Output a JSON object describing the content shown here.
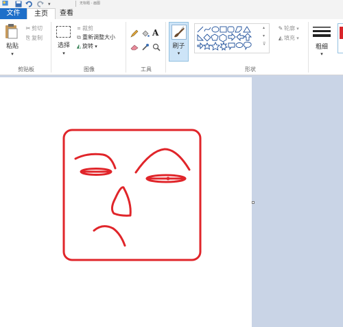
{
  "title_bar": {
    "doc_title": "无标题 - 画图"
  },
  "tabs": [
    {
      "label": "文件"
    },
    {
      "label": "主页"
    },
    {
      "label": "查看"
    }
  ],
  "ribbon": {
    "clipboard": {
      "paste": "粘贴",
      "cut": "剪切",
      "copy": "复制",
      "group": "剪贴板"
    },
    "image": {
      "select": "选择",
      "crop": "裁剪",
      "resize": "重新调整大小",
      "rotate": "旋转",
      "group": "图像"
    },
    "tools": {
      "group": "工具"
    },
    "brushes": {
      "label": "刷子"
    },
    "shapes": {
      "outline": "轮廓",
      "fill": "填充",
      "group": "形状"
    },
    "size": {
      "label": "粗细"
    }
  },
  "colors": {
    "file_tab": "#1e6fc9",
    "stroke": "#e0252a",
    "canvas_bg": "#c9d4e6",
    "accent_red": "#d8242a"
  }
}
